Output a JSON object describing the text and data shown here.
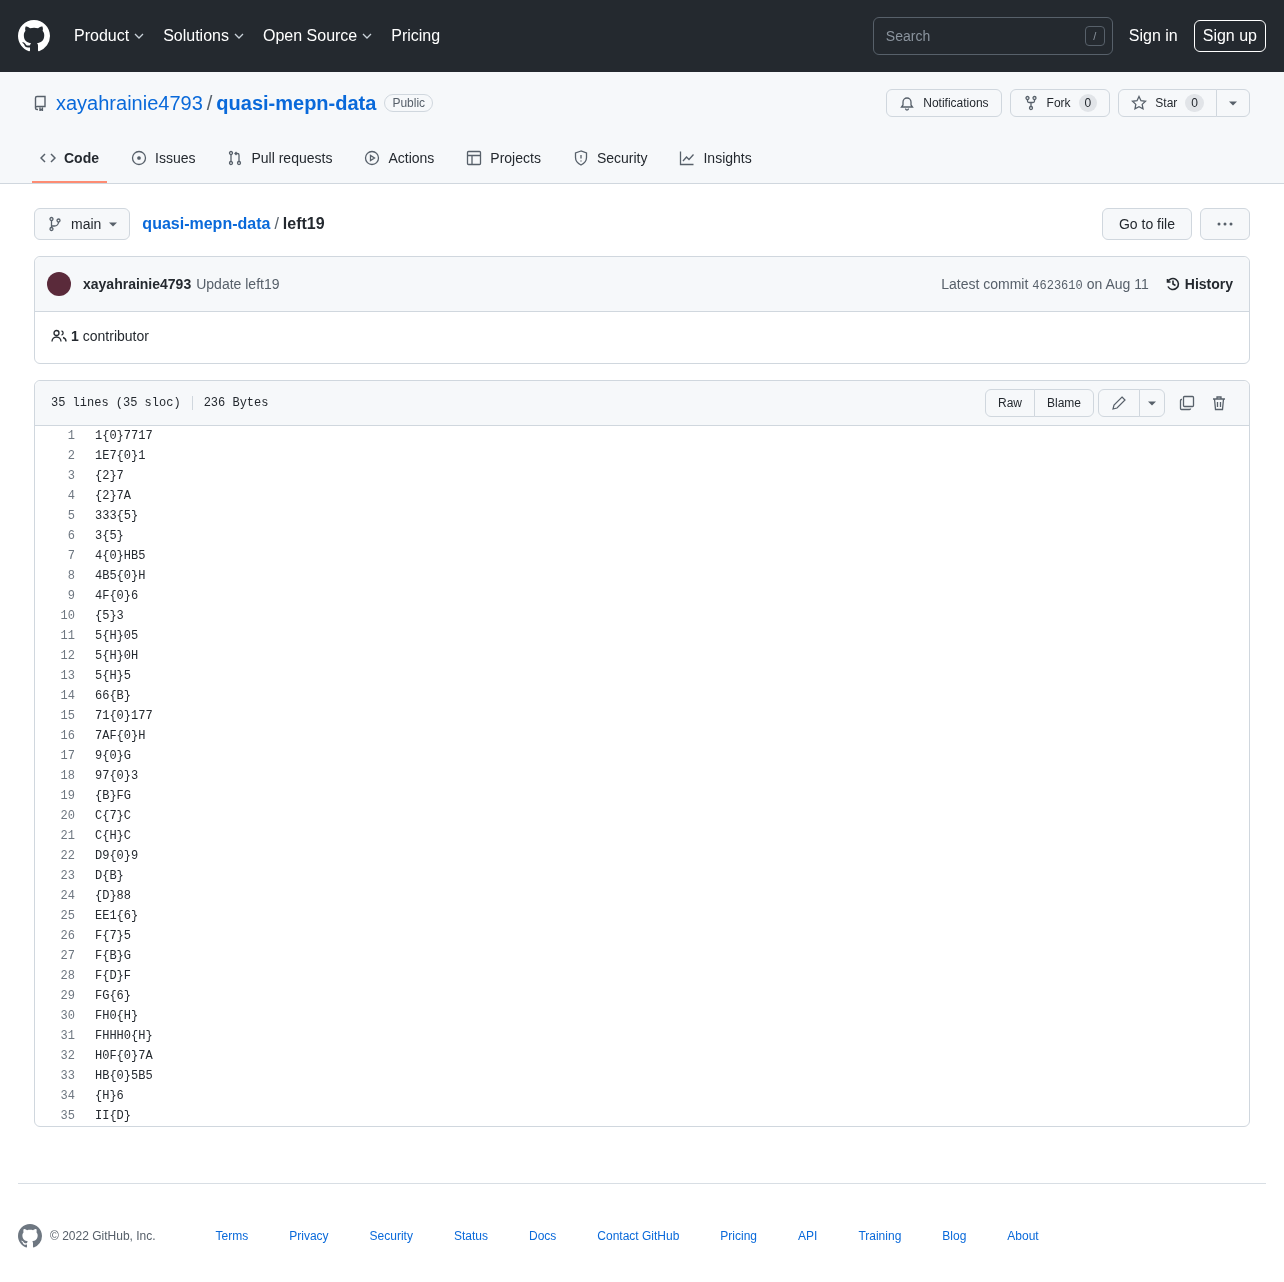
{
  "header": {
    "nav": [
      {
        "label": "Product",
        "has_menu": true
      },
      {
        "label": "Solutions",
        "has_menu": true
      },
      {
        "label": "Open Source",
        "has_menu": true
      },
      {
        "label": "Pricing",
        "has_menu": false
      }
    ],
    "search": {
      "placeholder": "Search",
      "shortcut": "/"
    },
    "sign_in": "Sign in",
    "sign_up": "Sign up"
  },
  "repo": {
    "owner": "xayahrainie4793",
    "separator": "/",
    "name": "quasi-mepn-data",
    "visibility": "Public",
    "notifications": "Notifications",
    "fork": {
      "label": "Fork",
      "count": "0"
    },
    "star": {
      "label": "Star",
      "count": "0"
    }
  },
  "tabs": [
    {
      "label": "Code",
      "selected": true
    },
    {
      "label": "Issues",
      "selected": false
    },
    {
      "label": "Pull requests",
      "selected": false
    },
    {
      "label": "Actions",
      "selected": false
    },
    {
      "label": "Projects",
      "selected": false
    },
    {
      "label": "Security",
      "selected": false
    },
    {
      "label": "Insights",
      "selected": false
    }
  ],
  "file_nav": {
    "branch": "main",
    "repo_link": "quasi-mepn-data",
    "separator": "/",
    "file": "left19",
    "go_to_file": "Go to file"
  },
  "commit": {
    "author": "xayahrainie4793",
    "message": "Update left19",
    "latest": "Latest commit",
    "sha": "4623610",
    "date": "on Aug 11",
    "history": "History"
  },
  "contributors": {
    "count": "1",
    "label": "contributor"
  },
  "file": {
    "lines_info": "35 lines (35 sloc)",
    "size": "236 Bytes",
    "raw": "Raw",
    "blame": "Blame",
    "lines": [
      {
        "n": "1",
        "text": "1{0}7717"
      },
      {
        "n": "2",
        "text": "1E7{0}1"
      },
      {
        "n": "3",
        "text": "{2}7"
      },
      {
        "n": "4",
        "text": "{2}7A"
      },
      {
        "n": "5",
        "text": "333{5}"
      },
      {
        "n": "6",
        "text": "3{5}"
      },
      {
        "n": "7",
        "text": "4{0}HB5"
      },
      {
        "n": "8",
        "text": "4B5{0}H"
      },
      {
        "n": "9",
        "text": "4F{0}6"
      },
      {
        "n": "10",
        "text": "{5}3"
      },
      {
        "n": "11",
        "text": "5{H}05"
      },
      {
        "n": "12",
        "text": "5{H}0H"
      },
      {
        "n": "13",
        "text": "5{H}5"
      },
      {
        "n": "14",
        "text": "66{B}"
      },
      {
        "n": "15",
        "text": "71{0}177"
      },
      {
        "n": "16",
        "text": "7AF{0}H"
      },
      {
        "n": "17",
        "text": "9{0}G"
      },
      {
        "n": "18",
        "text": "97{0}3"
      },
      {
        "n": "19",
        "text": "{B}FG"
      },
      {
        "n": "20",
        "text": "C{7}C"
      },
      {
        "n": "21",
        "text": "C{H}C"
      },
      {
        "n": "22",
        "text": "D9{0}9"
      },
      {
        "n": "23",
        "text": "D{B}"
      },
      {
        "n": "24",
        "text": "{D}88"
      },
      {
        "n": "25",
        "text": "EE1{6}"
      },
      {
        "n": "26",
        "text": "F{7}5"
      },
      {
        "n": "27",
        "text": "F{B}G"
      },
      {
        "n": "28",
        "text": "F{D}F"
      },
      {
        "n": "29",
        "text": "FG{6}"
      },
      {
        "n": "30",
        "text": "FH0{H}"
      },
      {
        "n": "31",
        "text": "FHHH0{H}"
      },
      {
        "n": "32",
        "text": "H0F{0}7A"
      },
      {
        "n": "33",
        "text": "HB{0}5B5"
      },
      {
        "n": "34",
        "text": "{H}6"
      },
      {
        "n": "35",
        "text": "II{D}"
      }
    ]
  },
  "footer": {
    "copyright": "© 2022 GitHub, Inc.",
    "links": [
      "Terms",
      "Privacy",
      "Security",
      "Status",
      "Docs",
      "Contact GitHub",
      "Pricing",
      "API",
      "Training",
      "Blog",
      "About"
    ]
  }
}
